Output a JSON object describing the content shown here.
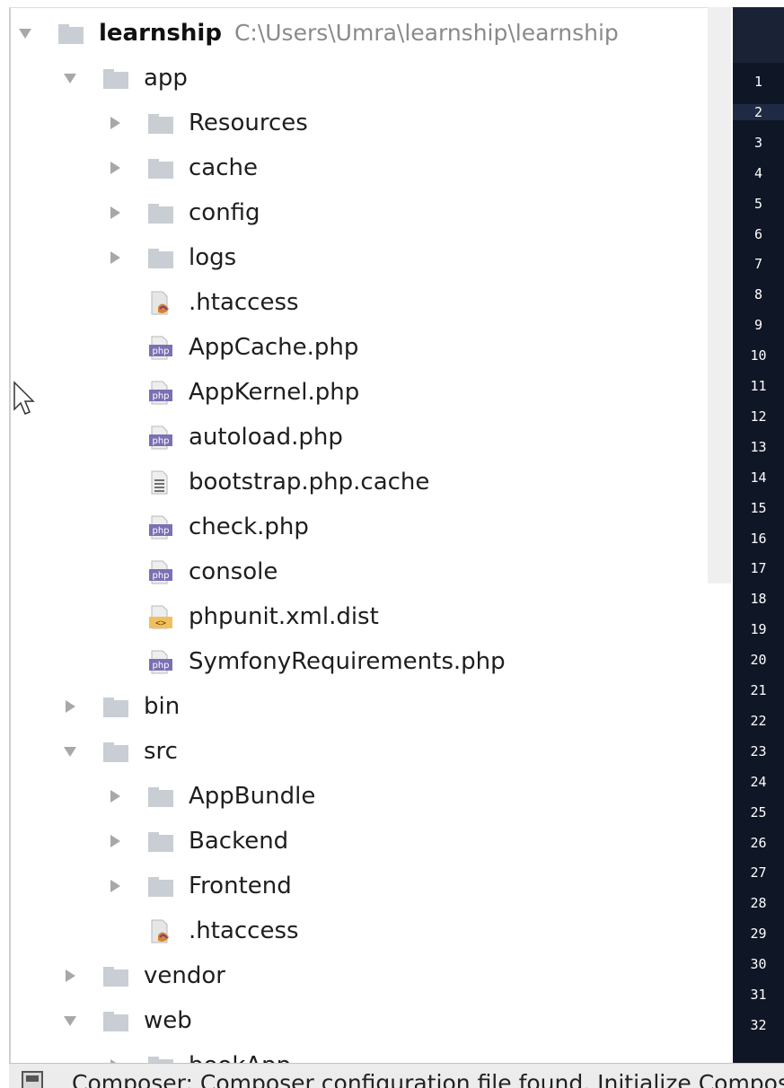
{
  "project_tree": {
    "root": {
      "label": "learnship",
      "path": "C:\\Users\\Umra\\learnship\\learnship"
    },
    "nodes": [
      {
        "label": "app",
        "expanded": true,
        "icon": "folder-icon"
      },
      {
        "label": "Resources",
        "expanded": false,
        "icon": "folder-icon"
      },
      {
        "label": "cache",
        "expanded": false,
        "icon": "folder-icon"
      },
      {
        "label": "config",
        "expanded": false,
        "icon": "folder-icon"
      },
      {
        "label": "logs",
        "expanded": false,
        "icon": "folder-icon"
      },
      {
        "label": ".htaccess",
        "icon": "htaccess-file-icon"
      },
      {
        "label": "AppCache.php",
        "icon": "php-file-icon"
      },
      {
        "label": "AppKernel.php",
        "icon": "php-file-icon"
      },
      {
        "label": "autoload.php",
        "icon": "php-file-icon"
      },
      {
        "label": "bootstrap.php.cache",
        "icon": "text-file-icon"
      },
      {
        "label": "check.php",
        "icon": "php-file-icon"
      },
      {
        "label": "console",
        "icon": "php-file-icon"
      },
      {
        "label": "phpunit.xml.dist",
        "icon": "xml-file-icon"
      },
      {
        "label": "SymfonyRequirements.php",
        "icon": "php-file-icon"
      },
      {
        "label": "bin",
        "expanded": false,
        "icon": "folder-icon"
      },
      {
        "label": "src",
        "expanded": true,
        "icon": "folder-icon"
      },
      {
        "label": "AppBundle",
        "expanded": false,
        "icon": "folder-icon"
      },
      {
        "label": "Backend",
        "expanded": false,
        "icon": "folder-icon"
      },
      {
        "label": "Frontend",
        "expanded": false,
        "icon": "folder-icon"
      },
      {
        "label": ".htaccess",
        "icon": "htaccess-file-icon"
      },
      {
        "label": "vendor",
        "expanded": false,
        "icon": "folder-icon"
      },
      {
        "label": "web",
        "expanded": true,
        "icon": "folder-icon"
      },
      {
        "label": "bookApp",
        "expanded": false,
        "icon": "folder-icon"
      }
    ]
  },
  "editor": {
    "line_numbers": [
      "1",
      "2",
      "3",
      "4",
      "5",
      "6",
      "7",
      "8",
      "9",
      "10",
      "11",
      "12",
      "13",
      "14",
      "15",
      "16",
      "17",
      "18",
      "19",
      "20",
      "21",
      "22",
      "23",
      "24",
      "25",
      "26",
      "27",
      "28",
      "29",
      "30",
      "31",
      "32"
    ],
    "current_line": "2"
  },
  "status_bar": {
    "message": "Composer: Composer configuration file found. Initialize Composer"
  },
  "colors": {
    "folder": "#c9ced4",
    "editor_background": "#0f1626",
    "php_badge": "#7c6fb4",
    "xml_badge": "#e8a33a",
    "arrow": "#a8a8a8"
  }
}
